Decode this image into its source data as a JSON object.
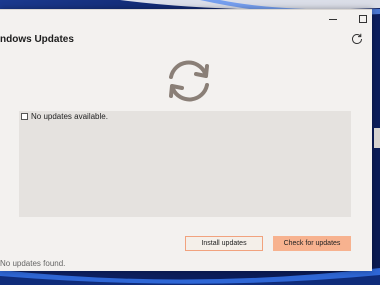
{
  "window": {
    "title": "ndows Updates",
    "minimize_icon": "minimize-icon",
    "maximize_icon": "maximize-icon"
  },
  "header": {
    "refresh_icon": "refresh-icon"
  },
  "main": {
    "status_icon": "sync-icon",
    "panel": {
      "checkbox_label": "No updates available.",
      "checked": false
    },
    "buttons": {
      "install_label": "Install updates",
      "check_label": "Check for updates"
    },
    "status_text": "No updates found."
  },
  "colors": {
    "accent": "#f7b28f",
    "accent_border": "#f1a27e",
    "icon": "#8a7f77"
  }
}
